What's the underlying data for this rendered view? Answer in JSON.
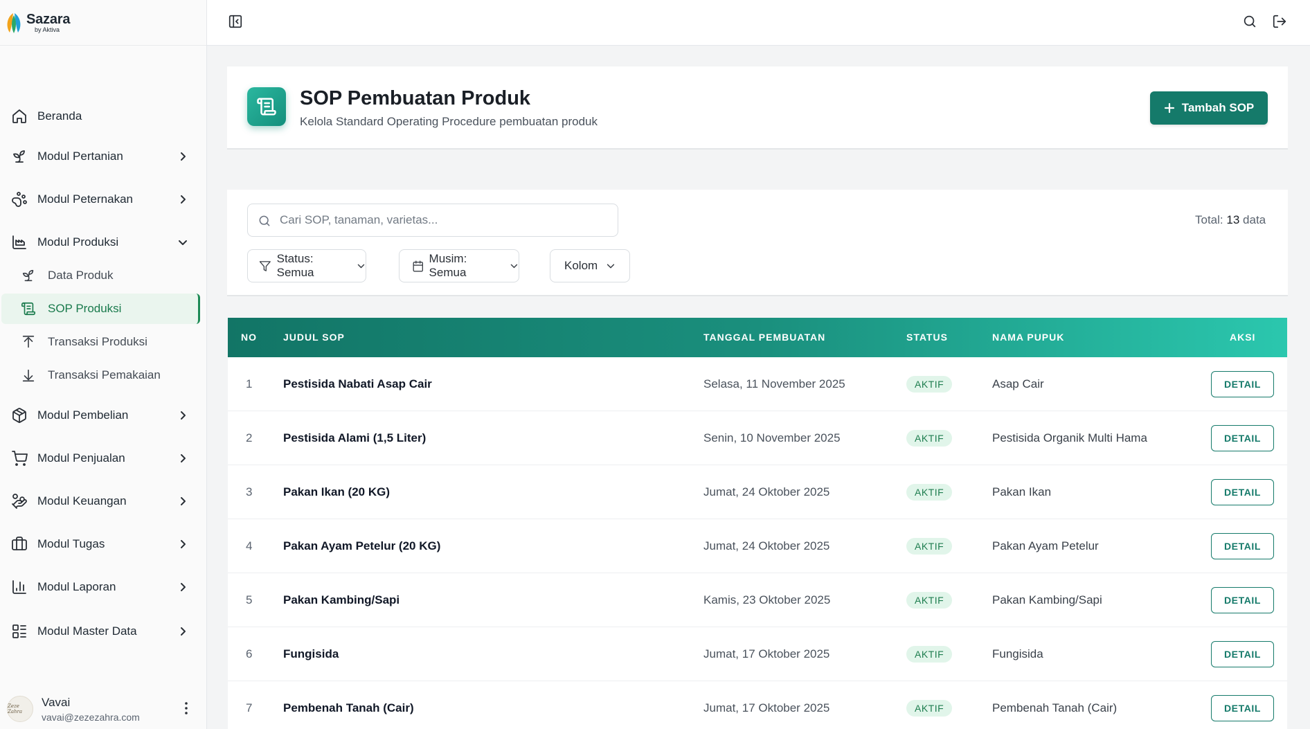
{
  "brand": {
    "name": "Sazara",
    "sub": "by Aktiva"
  },
  "sidebar": {
    "items": [
      {
        "label": "Beranda",
        "icon": "home-icon"
      },
      {
        "label": "Modul Pertanian",
        "icon": "sprout-icon"
      },
      {
        "label": "Modul Peternakan",
        "icon": "paw-icon"
      },
      {
        "label": "Modul Produksi",
        "icon": "factory-icon"
      },
      {
        "label": "Modul Pembelian",
        "icon": "package-icon"
      },
      {
        "label": "Modul Penjualan",
        "icon": "cart-icon"
      },
      {
        "label": "Modul Keuangan",
        "icon": "hand-coins-icon"
      },
      {
        "label": "Modul Tugas",
        "icon": "briefcase-icon"
      },
      {
        "label": "Modul Laporan",
        "icon": "bar-chart-icon"
      },
      {
        "label": "Modul Master Data",
        "icon": "list-icon"
      }
    ],
    "subitems": [
      {
        "label": "Data Produk",
        "icon": "sprout-icon"
      },
      {
        "label": "SOP Produksi",
        "icon": "scroll-icon",
        "active": true
      },
      {
        "label": "Transaksi Produksi",
        "icon": "upload-icon"
      },
      {
        "label": "Transaksi Pemakaian",
        "icon": "download-icon"
      }
    ],
    "active_color": "#197a4c"
  },
  "user": {
    "name": "Vavai",
    "email": "vavai@zezezahra.com",
    "avatar_text": "Zeze Zahra"
  },
  "header": {
    "title": "SOP Pembuatan Produk",
    "subtitle": "Kelola Standard Operating Procedure pembuatan produk",
    "add_label": "Tambah SOP",
    "accent": "#157a6a"
  },
  "filters": {
    "search_placeholder": "Cari SOP, tanaman, varietas...",
    "total_prefix": "Total:",
    "total_count": "13",
    "total_suffix": "data",
    "status_label": "Status: Semua",
    "musim_label": "Musim: Semua",
    "kolom_label": "Kolom"
  },
  "table": {
    "headers": [
      "NO",
      "JUDUL SOP",
      "TANGGAL PEMBUATAN",
      "STATUS",
      "NAMA PUPUK",
      "AKSI"
    ],
    "action_label": "DETAIL",
    "rows": [
      {
        "no": "1",
        "title": "Pestisida Nabati Asap Cair",
        "date": "Selasa, 11 November 2025",
        "status": "AKTIF",
        "pupuk": "Asap Cair"
      },
      {
        "no": "2",
        "title": "Pestisida Alami (1,5 Liter)",
        "date": "Senin, 10 November 2025",
        "status": "AKTIF",
        "pupuk": "Pestisida Organik Multi Hama"
      },
      {
        "no": "3",
        "title": "Pakan Ikan (20 KG)",
        "date": "Jumat, 24 Oktober 2025",
        "status": "AKTIF",
        "pupuk": "Pakan Ikan"
      },
      {
        "no": "4",
        "title": "Pakan Ayam Petelur (20 KG)",
        "date": "Jumat, 24 Oktober 2025",
        "status": "AKTIF",
        "pupuk": "Pakan Ayam Petelur"
      },
      {
        "no": "5",
        "title": "Pakan Kambing/Sapi",
        "date": "Kamis, 23 Oktober 2025",
        "status": "AKTIF",
        "pupuk": "Pakan Kambing/Sapi"
      },
      {
        "no": "6",
        "title": "Fungisida",
        "date": "Jumat, 17 Oktober 2025",
        "status": "AKTIF",
        "pupuk": "Fungisida"
      },
      {
        "no": "7",
        "title": "Pembenah Tanah (Cair)",
        "date": "Jumat, 17 Oktober 2025",
        "status": "AKTIF",
        "pupuk": "Pembenah Tanah (Cair)"
      }
    ]
  }
}
